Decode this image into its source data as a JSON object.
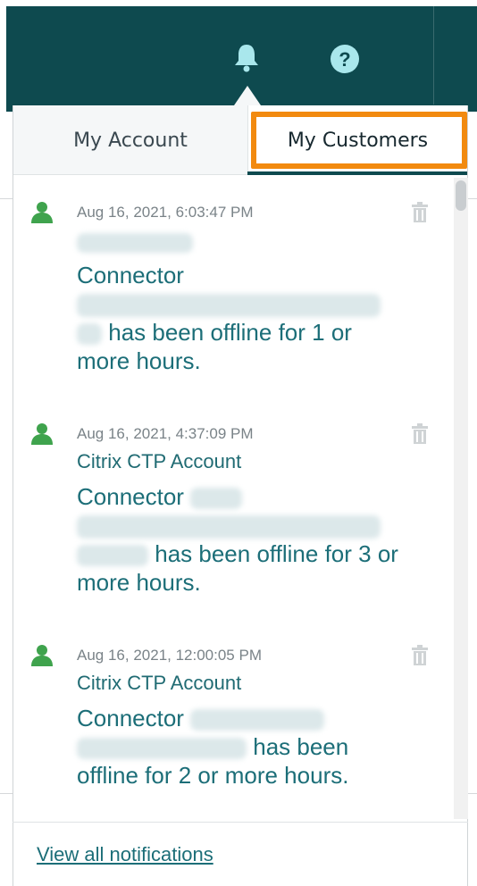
{
  "header": {
    "bell_icon": "bell-icon",
    "help_icon": "help-circle-icon",
    "background_color": "#0e4a4f"
  },
  "tabs": [
    {
      "label": "My Account",
      "active": false
    },
    {
      "label": "My Customers",
      "active": true
    }
  ],
  "notifications": [
    {
      "timestamp": "Aug 16, 2021, 6:03:47 PM",
      "account": "",
      "message_prefix": "Connector",
      "message_suffix": "has been offline for 1 or more hours.",
      "icon": "user-icon"
    },
    {
      "timestamp": "Aug 16, 2021, 4:37:09 PM",
      "account": "Citrix CTP Account",
      "message_prefix": "Connector",
      "message_suffix": "has been offline for 3 or more hours.",
      "icon": "user-icon"
    },
    {
      "timestamp": "Aug 16, 2021, 12:00:05 PM",
      "account": "Citrix CTP Account",
      "message_prefix": "Connector",
      "message_suffix": "has been offline for 2 or more hours.",
      "icon": "user-icon"
    }
  ],
  "footer": {
    "view_all_label": "View all notifications"
  },
  "colors": {
    "accent": "#1c6e78",
    "highlight": "#f28a0f",
    "user_icon": "#3fa34d"
  }
}
